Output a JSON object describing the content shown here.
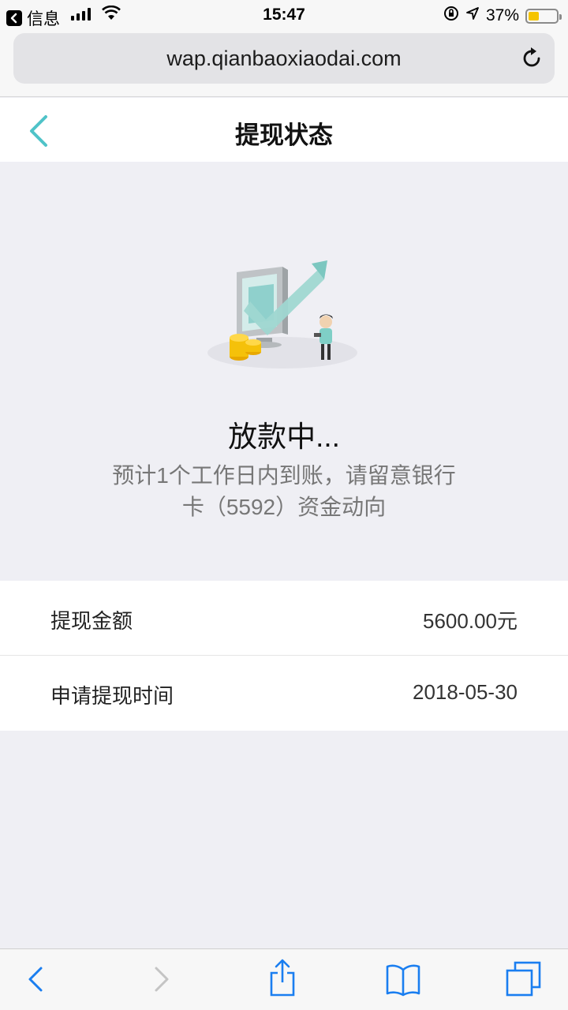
{
  "status_bar": {
    "back_app_label": "信息",
    "time": "15:47",
    "battery_percent": "37%",
    "battery_level": 0.37
  },
  "browser": {
    "url": "wap.qianbaoxiaodai.com"
  },
  "header": {
    "title": "提现状态"
  },
  "status": {
    "title": "放款中...",
    "description_line1": "预计1个工作日内到账，请留意银行",
    "description_line2": "卡（5592）资金动向"
  },
  "details": [
    {
      "label": "提现金额",
      "value": "5600.00元"
    },
    {
      "label": "申请提现时间",
      "value": "2018-05-30"
    }
  ],
  "colors": {
    "accent_teal": "#4fc3c8",
    "ios_blue": "#1a7ef0",
    "battery_yellow": "#f5c400"
  },
  "icons": {
    "back": "chevron-left-icon",
    "reload": "reload-icon",
    "share": "share-icon",
    "bookmarks": "book-icon",
    "tabs": "tabs-icon"
  }
}
